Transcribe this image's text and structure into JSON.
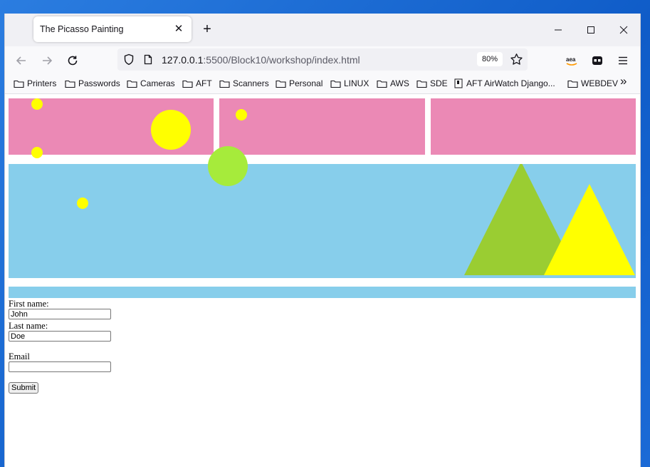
{
  "browser": {
    "tab_title": "The Picasso Painting",
    "new_tab_label": "+",
    "url_host": "127.0.0.1",
    "url_rest": ":5500/Block10/workshop/index.html",
    "zoom": "80%",
    "close_symbol": "✕",
    "bookmarks": [
      {
        "label": "Printers",
        "icon": "folder-icon"
      },
      {
        "label": "Passwords",
        "icon": "folder-icon"
      },
      {
        "label": "Cameras",
        "icon": "folder-icon"
      },
      {
        "label": "AFT",
        "icon": "folder-icon"
      },
      {
        "label": "Scanners",
        "icon": "folder-icon"
      },
      {
        "label": "Personal",
        "icon": "folder-icon"
      },
      {
        "label": "LINUX",
        "icon": "folder-icon"
      },
      {
        "label": "AWS",
        "icon": "folder-icon"
      },
      {
        "label": "SDE",
        "icon": "folder-icon"
      },
      {
        "label": "AFT AirWatch Django...",
        "icon": "page-icon"
      },
      {
        "label": "WEBDEV",
        "icon": "folder-icon"
      }
    ],
    "overflow_symbol": "»"
  },
  "page": {
    "form": {
      "first_name_label": "First name:",
      "first_name_value": "John",
      "last_name_label": "Last name:",
      "last_name_value": "Doe",
      "email_label": "Email",
      "email_value": "",
      "submit_label": "Submit"
    }
  },
  "colors": {
    "pink": "#eb89b5",
    "sky": "#87ceeb",
    "yellow": "#ffff00",
    "green_circle": "#a6eb3b",
    "green_triangle": "#9acd32"
  }
}
